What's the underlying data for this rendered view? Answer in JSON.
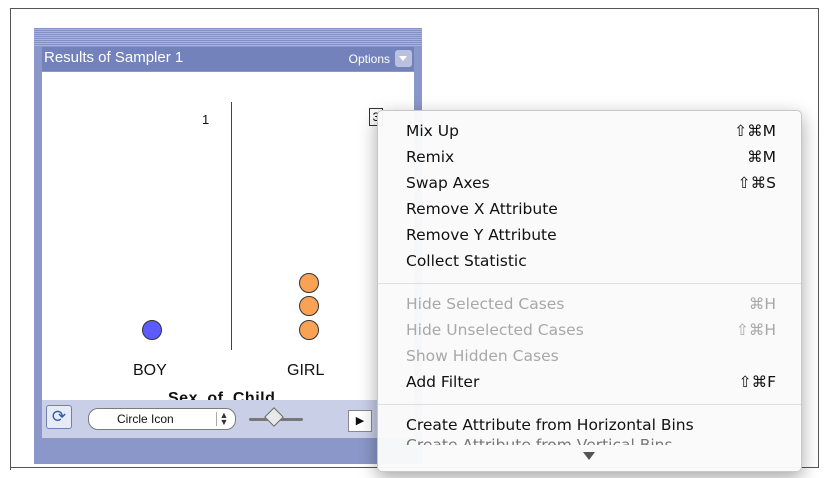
{
  "panel": {
    "title": "Results of Sampler 1",
    "options_label": "Options"
  },
  "plot": {
    "count_label": "1",
    "boxed_glyph": "3",
    "categories": [
      "BOY",
      "GIRL"
    ],
    "axis_name": "Sex_of_Child",
    "colors": {
      "boy": "#5b5bff",
      "girl": "#f8a256"
    },
    "counts": {
      "BOY": 1,
      "GIRL": 3
    }
  },
  "controls": {
    "icon_select_value": "Circle Icon",
    "refresh_icon": "refresh-icon",
    "pointer_icon": "pointer-icon"
  },
  "menu": {
    "items": [
      {
        "label": "Mix Up",
        "shortcut": "⇧⌘M",
        "enabled": true
      },
      {
        "label": "Remix",
        "shortcut": "⌘M",
        "enabled": true
      },
      {
        "label": "Swap Axes",
        "shortcut": "⇧⌘S",
        "enabled": true
      },
      {
        "label": "Remove X Attribute",
        "shortcut": "",
        "enabled": true
      },
      {
        "label": "Remove Y Attribute",
        "shortcut": "",
        "enabled": true
      },
      {
        "label": "Collect Statistic",
        "shortcut": "",
        "enabled": true
      },
      {
        "label": "Hide Selected Cases",
        "shortcut": "⌘H",
        "enabled": false
      },
      {
        "label": "Hide Unselected Cases",
        "shortcut": "⇧⌘H",
        "enabled": false
      },
      {
        "label": "Show Hidden Cases",
        "shortcut": "",
        "enabled": false
      },
      {
        "label": "Add Filter",
        "shortcut": "⇧⌘F",
        "enabled": true
      },
      {
        "label": "Create Attribute from Horizontal Bins",
        "shortcut": "",
        "enabled": true
      }
    ],
    "cutoff_text": "Create Attribute from Vertical Bins"
  }
}
